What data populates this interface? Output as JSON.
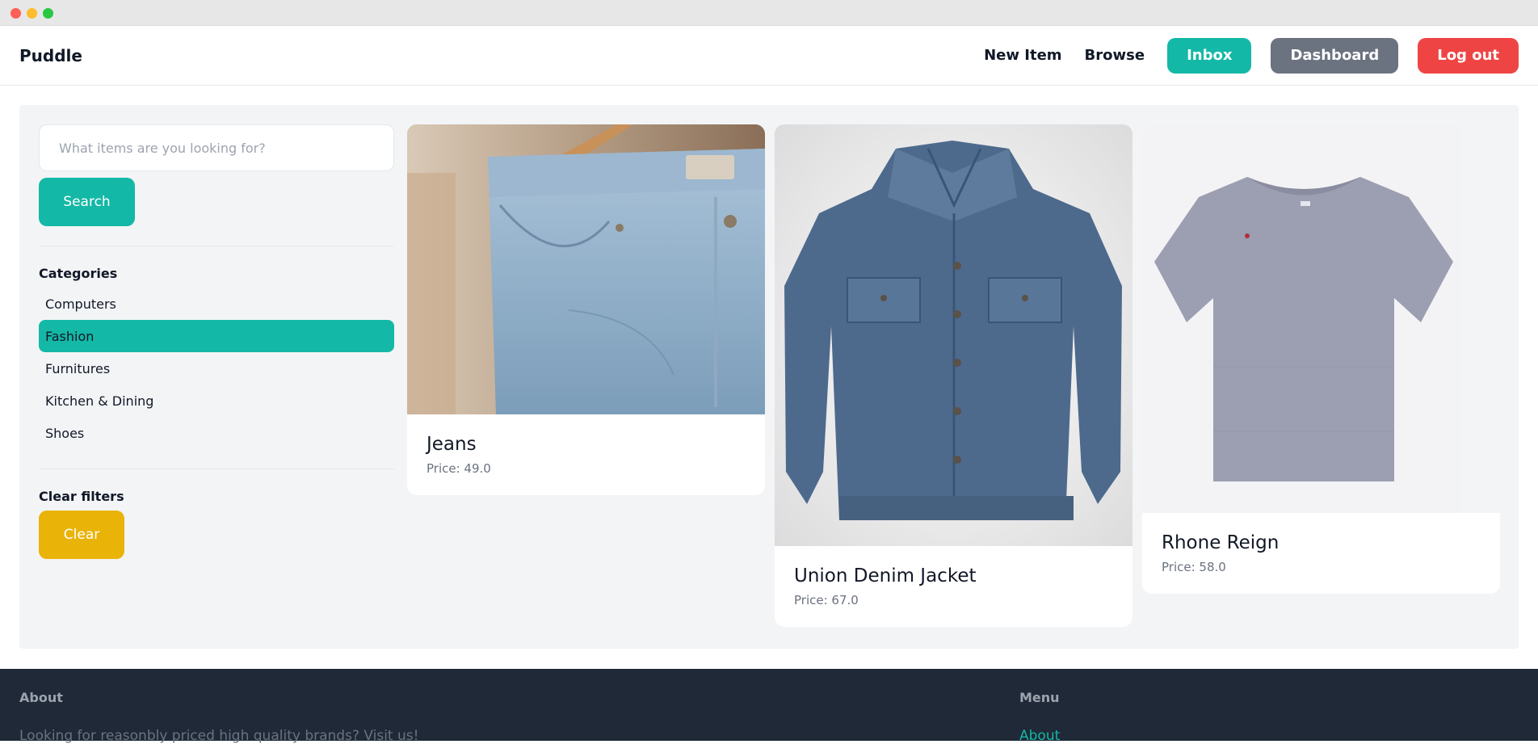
{
  "navbar": {
    "brand": "Puddle",
    "links": [
      "New Item",
      "Browse"
    ],
    "inbox_label": "Inbox",
    "dashboard_label": "Dashboard",
    "logout_label": "Log out"
  },
  "sidebar": {
    "search_placeholder": "What items are you looking for?",
    "search_button": "Search",
    "categories_title": "Categories",
    "categories": [
      "Computers",
      "Fashion",
      "Furnitures",
      "Kitchen & Dining",
      "Shoes"
    ],
    "active_category": "Fashion",
    "clear_title": "Clear filters",
    "clear_button": "Clear"
  },
  "items": [
    {
      "title": "Jeans",
      "price": "Price: 49.0"
    },
    {
      "title": "Union Denim Jacket",
      "price": "Price: 67.0"
    },
    {
      "title": "Rhone Reign",
      "price": "Price: 58.0"
    }
  ],
  "footer": {
    "about_heading": "About",
    "about_text": "Looking for reasonbly priced high quality brands? Visit us!",
    "menu_heading": "Menu",
    "menu_link": "About"
  },
  "colors": {
    "accent": "#14b8a6",
    "dashboard": "#6b7280",
    "logout": "#ef4444",
    "clear": "#eab308",
    "footer_bg": "#1f2937"
  }
}
